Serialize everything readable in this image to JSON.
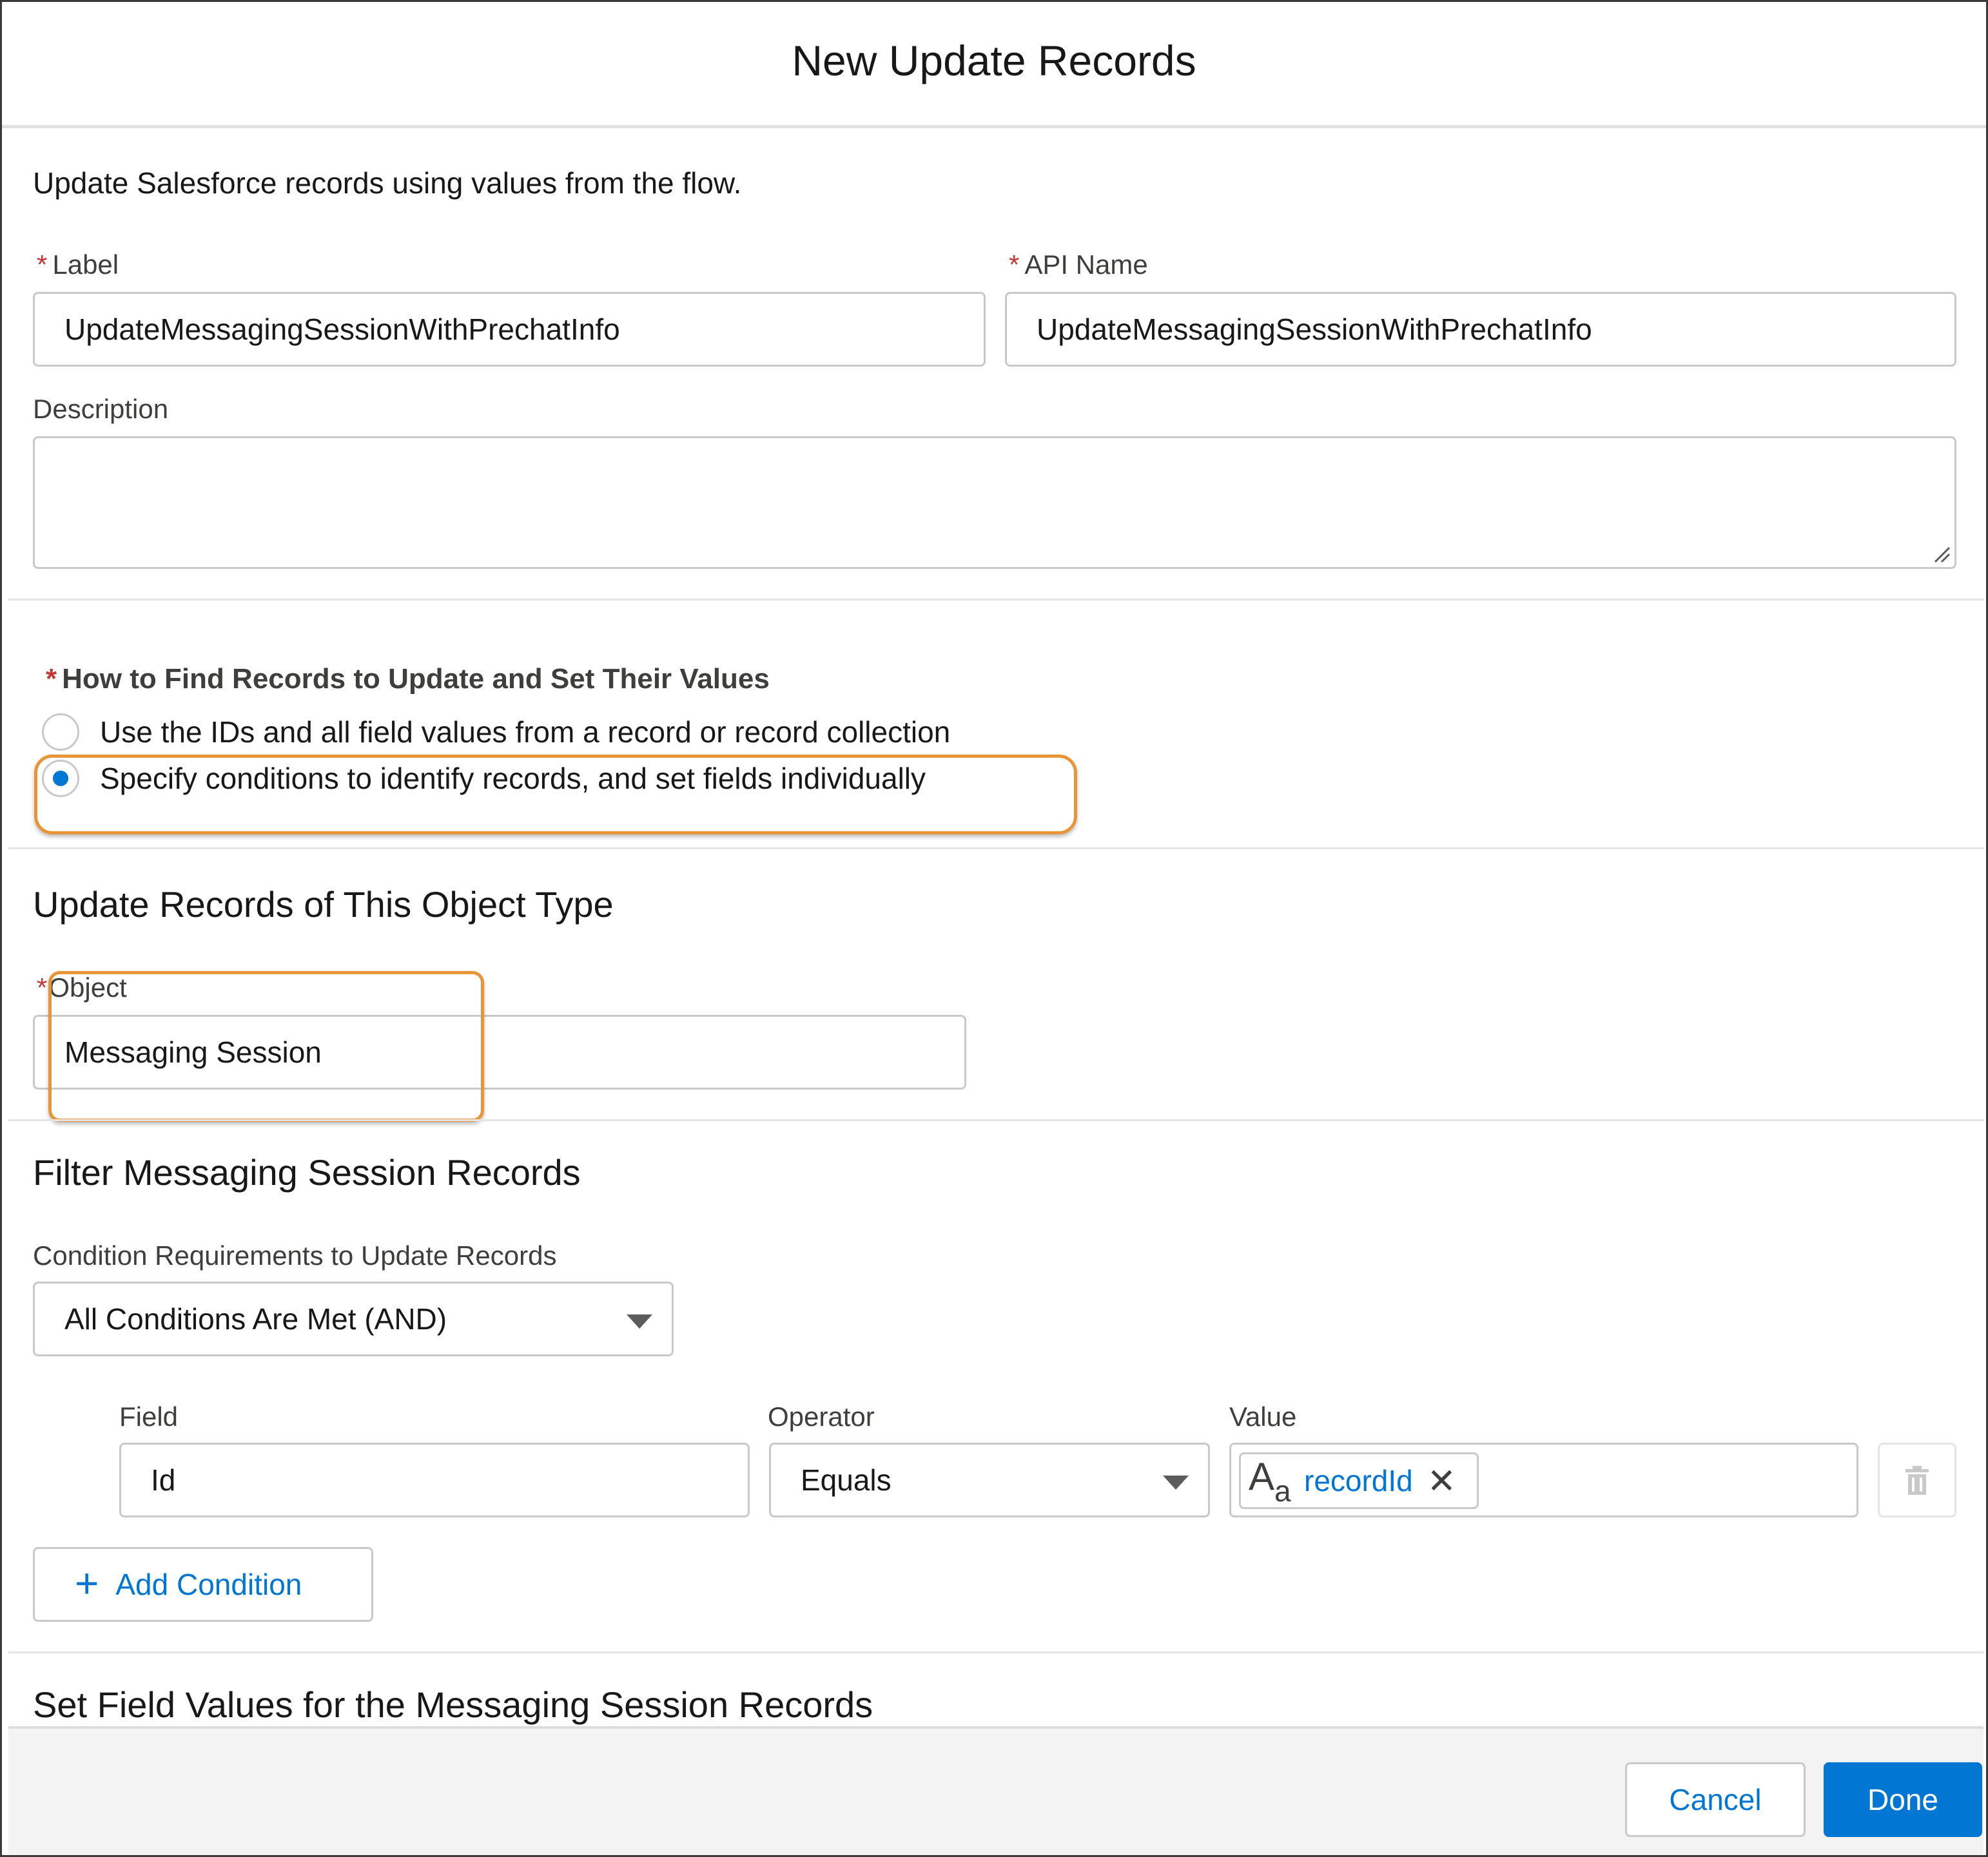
{
  "dialog": {
    "title": "New Update Records"
  },
  "intro": "Update Salesforce records using values from the flow.",
  "required_mark": "*",
  "label_field": {
    "label": "Label",
    "value": "UpdateMessagingSessionWithPrechatInfo"
  },
  "api_name_field": {
    "label": "API Name",
    "value": "UpdateMessagingSessionWithPrechatInfo"
  },
  "description_field": {
    "label": "Description",
    "value": ""
  },
  "find_records": {
    "heading": "How to Find Records to Update and Set Their Values",
    "options": [
      {
        "label": "Use the IDs and all field values from a record or record collection",
        "selected": false
      },
      {
        "label": "Specify conditions to identify records, and set fields individually",
        "selected": true
      }
    ]
  },
  "object_section": {
    "heading": "Update Records of This Object Type",
    "object_label": "Object",
    "object_value": "Messaging Session"
  },
  "filter_section": {
    "heading": "Filter Messaging Session Records",
    "requirement_label": "Condition Requirements to Update Records",
    "requirement_value": "All Conditions Are Met (AND)",
    "columns": {
      "field": "Field",
      "operator": "Operator",
      "value": "Value"
    },
    "condition": {
      "field": "Id",
      "operator": "Equals",
      "value": "recordId",
      "value_type_icon": "text-type-icon"
    },
    "add_condition_label": "Add Condition"
  },
  "set_values_section": {
    "heading": "Set Field Values for the Messaging Session Records"
  },
  "footer": {
    "cancel_label": "Cancel",
    "done_label": "Done"
  },
  "colors": {
    "brand": "#0176d3",
    "highlight": "#e8953a",
    "required": "#c23934"
  }
}
